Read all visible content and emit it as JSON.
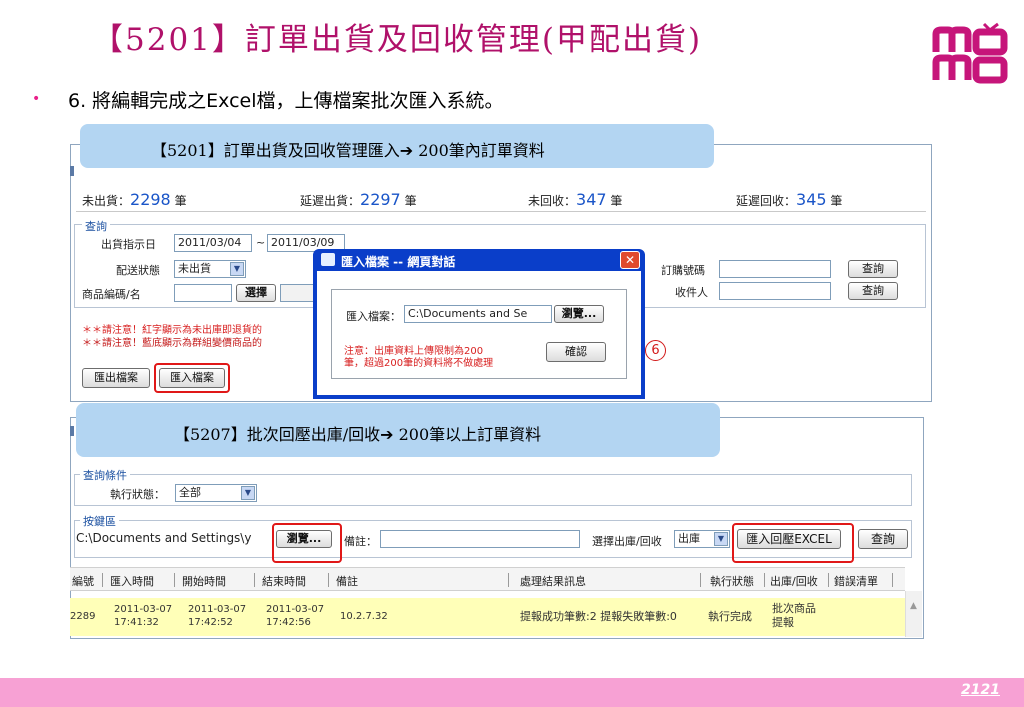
{
  "header": {
    "title": "【5201】訂單出貨及回收管理(甲配出貨)",
    "bullet": "6. 將編輯完成之Excel檔，上傳檔案批次匯入系統。"
  },
  "panel1": {
    "bubble": "【5201】訂單出貨及回收管理匯入➔ 200筆內訂單資料",
    "stats": {
      "unshipped_label": "未出貨：",
      "unshipped_value": "2298",
      "unshipped_unit": "筆",
      "delayed_label": "延遲出貨：",
      "delayed_value": "2297",
      "delayed_unit": "筆",
      "unreturned_label": "未回收：",
      "unreturned_value": "347",
      "unreturned_unit": "筆",
      "delayed_return_label": "延遲回收：",
      "delayed_return_value": "345",
      "delayed_return_unit": "筆"
    },
    "query": {
      "legend": "查詢",
      "ship_date_label": "出貨指示日",
      "date_from": "2011/03/04",
      "date_sep": "~",
      "date_to": "2011/03/09",
      "status_label": "配送狀態",
      "status_value": "未出貨",
      "product_label": "商品編碼/名",
      "select_button": "選擇",
      "order_no_label": "訂購號碼",
      "recipient_label": "收件人",
      "query_button_1": "查詢",
      "query_button_2": "查詢"
    },
    "notes": [
      "＊＊請注意！紅字顯示為未出庫即退貨的",
      "＊＊請注意！藍底顯示為群組變價商品的"
    ],
    "export_button": "匯出檔案",
    "import_button": "匯入檔案"
  },
  "dialog": {
    "title": "匯入檔案 -- 網頁對話",
    "close": "✕",
    "file_label": "匯入檔案：",
    "file_path": "C:\\Documents and Se",
    "browse_button": "瀏覽...",
    "notice_line1": "注意：出庫資料上傳限制為200",
    "notice_line2": "筆，超過200筆的資料將不做處理",
    "confirm_button": "確認"
  },
  "step_marker": "6",
  "panel2": {
    "bubble": "【5207】批次回壓出庫/回收➔ 200筆以上訂單資料",
    "conditions": {
      "legend": "查詢條件",
      "exec_status_label": "執行狀態：",
      "exec_status_value": "全部"
    },
    "buttons_area": {
      "legend": "按鍵區",
      "file_path": "C:\\Documents and Settings\\y",
      "browse_button": "瀏覽...",
      "remark_label": "備註：",
      "direction_label": "選擇出庫/回收",
      "direction_value": "出庫",
      "import_excel_button": "匯入回壓EXCEL",
      "query_button": "查詢"
    },
    "table": {
      "headers": [
        "編號",
        "匯入時間",
        "開始時間",
        "結束時間",
        "備註",
        "處理結果訊息",
        "執行狀態",
        "出庫/回收",
        "錯誤清單"
      ],
      "row": {
        "id": "2289",
        "import_date": "2011-03-07",
        "import_time": "17:41:32",
        "start_date": "2011-03-07",
        "start_time": "17:42:52",
        "end_date": "2011-03-07",
        "end_time": "17:42:56",
        "remark": "10.2.7.32",
        "result": "提報成功筆數:2 提報失敗筆數:0",
        "status": "執行完成",
        "direction_line1": "批次商品",
        "direction_line2": "提報"
      }
    }
  },
  "footer": {
    "page_number": "2121"
  },
  "colors": {
    "title": "#b0116a",
    "bubble": "#b3d5f2",
    "footer": "#f7a1d4",
    "highlight_row": "#ffffb8",
    "accent_red": "#e01818",
    "stat_blue": "#1a55c8"
  }
}
